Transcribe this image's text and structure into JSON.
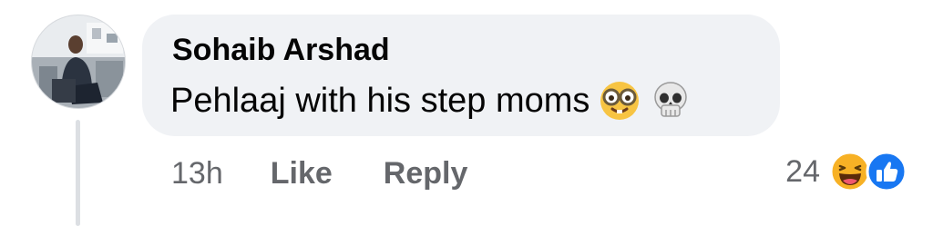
{
  "comment": {
    "author": "Sohaib Arshad",
    "text": "Pehlaaj with his step moms",
    "emojis": [
      "nerd-face-emoji",
      "skull-emoji"
    ],
    "time": "13h",
    "like_label": "Like",
    "reply_label": "Reply",
    "reaction_count": "24",
    "reactions": [
      "haha-reaction-icon",
      "like-reaction-icon"
    ]
  },
  "colors": {
    "bubble": "#f0f2f5",
    "text": "#050505",
    "meta": "#65676b",
    "like_blue": "#1877f2",
    "haha_yellow": "#f7b125"
  }
}
